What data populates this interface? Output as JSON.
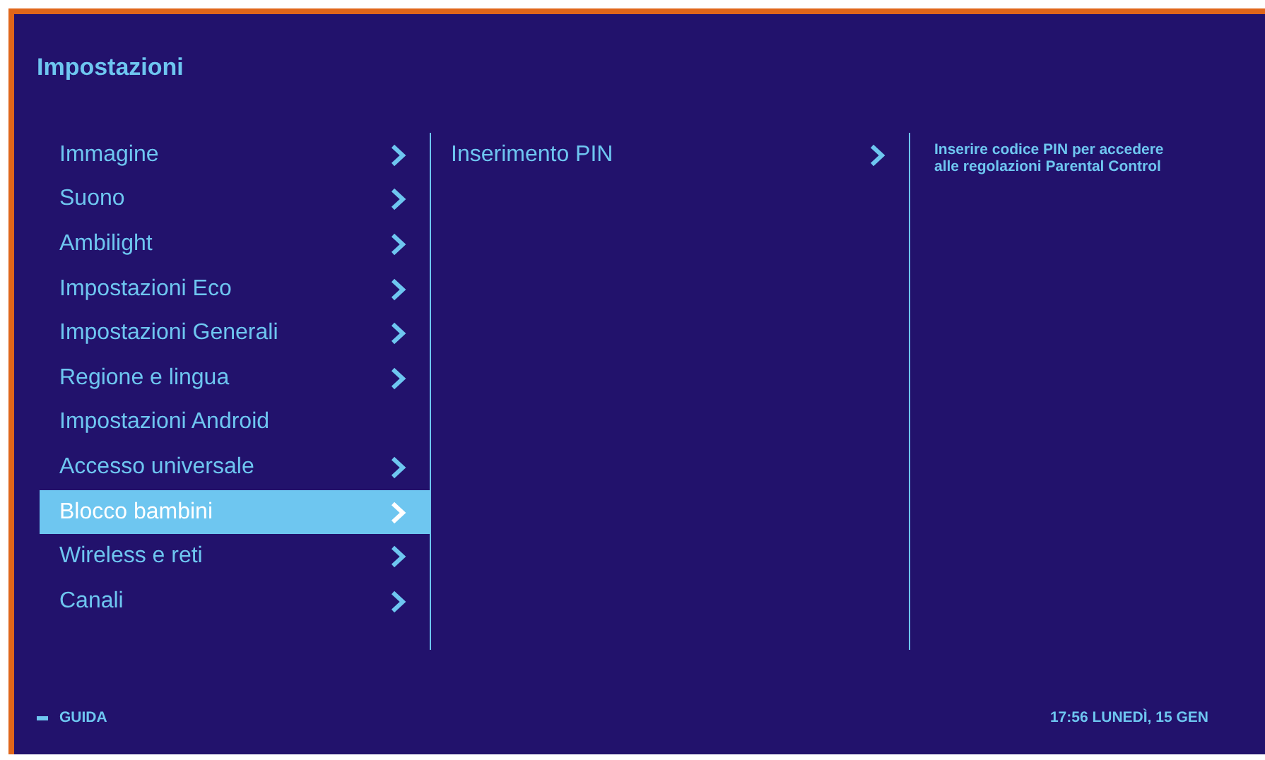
{
  "title": "Impostazioni",
  "menu": [
    {
      "label": "Immagine",
      "has_arrow": true,
      "selected": false
    },
    {
      "label": "Suono",
      "has_arrow": true,
      "selected": false
    },
    {
      "label": "Ambilight",
      "has_arrow": true,
      "selected": false
    },
    {
      "label": "Impostazioni Eco",
      "has_arrow": true,
      "selected": false
    },
    {
      "label": "Impostazioni Generali",
      "has_arrow": true,
      "selected": false
    },
    {
      "label": "Regione e lingua",
      "has_arrow": true,
      "selected": false
    },
    {
      "label": "Impostazioni Android",
      "has_arrow": false,
      "selected": false
    },
    {
      "label": "Accesso universale",
      "has_arrow": true,
      "selected": false
    },
    {
      "label": "Blocco bambini",
      "has_arrow": true,
      "selected": true
    },
    {
      "label": "Wireless e reti",
      "has_arrow": true,
      "selected": false
    },
    {
      "label": "Canali",
      "has_arrow": true,
      "selected": false
    }
  ],
  "submenu": [
    {
      "label": "Inserimento PIN",
      "has_arrow": true,
      "selected": false
    }
  ],
  "help_text": "Inserire codice PIN per accedere alle regolazioni  Parental Control",
  "footer": {
    "guide_label": "GUIDA",
    "datetime": "17:56 LUNEDÌ, 15 GEN"
  }
}
